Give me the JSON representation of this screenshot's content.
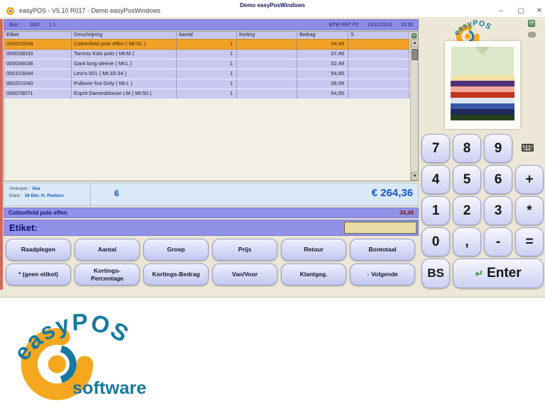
{
  "window": {
    "app_title": "easyPOS - V5.10 R017 - Demo easyPosWindows",
    "controls": {
      "minimize": "–",
      "maximize": "▢",
      "close": "✕"
    }
  },
  "topbar": {
    "bon_label": "Bon :",
    "bon_number": "1637",
    "bon_extra": "1    1",
    "title": "Demo easyPosWindows",
    "btw": "BTW PRT P2",
    "date": "10/12/2016",
    "time": "13:33"
  },
  "table": {
    "columns": [
      "Etiket",
      "Omschrijving",
      "Aantal",
      "Korting",
      "Bedrag",
      "S"
    ],
    "rows": [
      {
        "etiket": "000016049",
        "omschrijving": "Cottonfield polo effen  ( Mt:XL )",
        "aantal": "1",
        "korting": "",
        "bedrag": "34,49"
      },
      {
        "etiket": "000039033",
        "omschrijving": "Tommy Kids polo  ( Mt:M )",
        "aantal": "1",
        "korting": "",
        "bedrag": "37,49"
      },
      {
        "etiket": "000036038",
        "omschrijving": "Gant long sleeve  ( Mt:L )",
        "aantal": "1",
        "korting": "",
        "bedrag": "32,49"
      },
      {
        "etiket": "000103044",
        "omschrijving": "Levi's 501  ( Mt:33-34 )",
        "aantal": "1",
        "korting": "",
        "bedrag": "54,95"
      },
      {
        "etiket": "000201040",
        "omschrijving": "Pullover frui Only  ( Mt:L )",
        "aantal": "1",
        "korting": "",
        "bedrag": "39,99"
      },
      {
        "etiket": "000078071",
        "omschrijving": "Esprit Damesblouse LM ( Mt:50 )",
        "aantal": "1",
        "korting": "",
        "bedrag": "54,95"
      }
    ]
  },
  "summary": {
    "verkoper_label": "Verkoper :",
    "verkoper": "Ilse",
    "klant_label": "Klant :",
    "klant": "16  Dhr. H. Peeters",
    "item_count": "6",
    "total": "€ 264,36"
  },
  "selection": {
    "name": "Cottonfield polo effen",
    "price": "34,49"
  },
  "etiket_bar": {
    "label": "Etiket:",
    "value": ""
  },
  "function_buttons": {
    "row1": [
      "Raadplegen",
      "Aantal",
      "Groep",
      "Prijs",
      "Retour",
      "Bontotaal"
    ],
    "row2": [
      "* (geen etiket)",
      "Kortings-Percentage",
      "Kortings-Bedrag",
      "Van/Voor",
      "Klantgeg.",
      "Volgende"
    ]
  },
  "numpad": {
    "row1": [
      "7",
      "8",
      "9"
    ],
    "row2": [
      "4",
      "5",
      "6",
      "+"
    ],
    "row3": [
      "1",
      "2",
      "3",
      "*"
    ],
    "row4": [
      "0",
      ",",
      "-",
      "="
    ],
    "bs": "BS",
    "enter": "Enter"
  },
  "icons": {
    "scroll_up": "▲",
    "scroll_down": "▼",
    "enter_arrow": "↵",
    "volgende_chevron": "›"
  },
  "logo": {
    "brand": "easyPOS",
    "sub": "software"
  },
  "colors": {
    "accent_purple": "#8d8de6",
    "selected_row_orange": "#f0a227",
    "total_blue": "#1456c8",
    "brand_teal": "#1878a2",
    "brand_orange": "#f5a81f"
  }
}
